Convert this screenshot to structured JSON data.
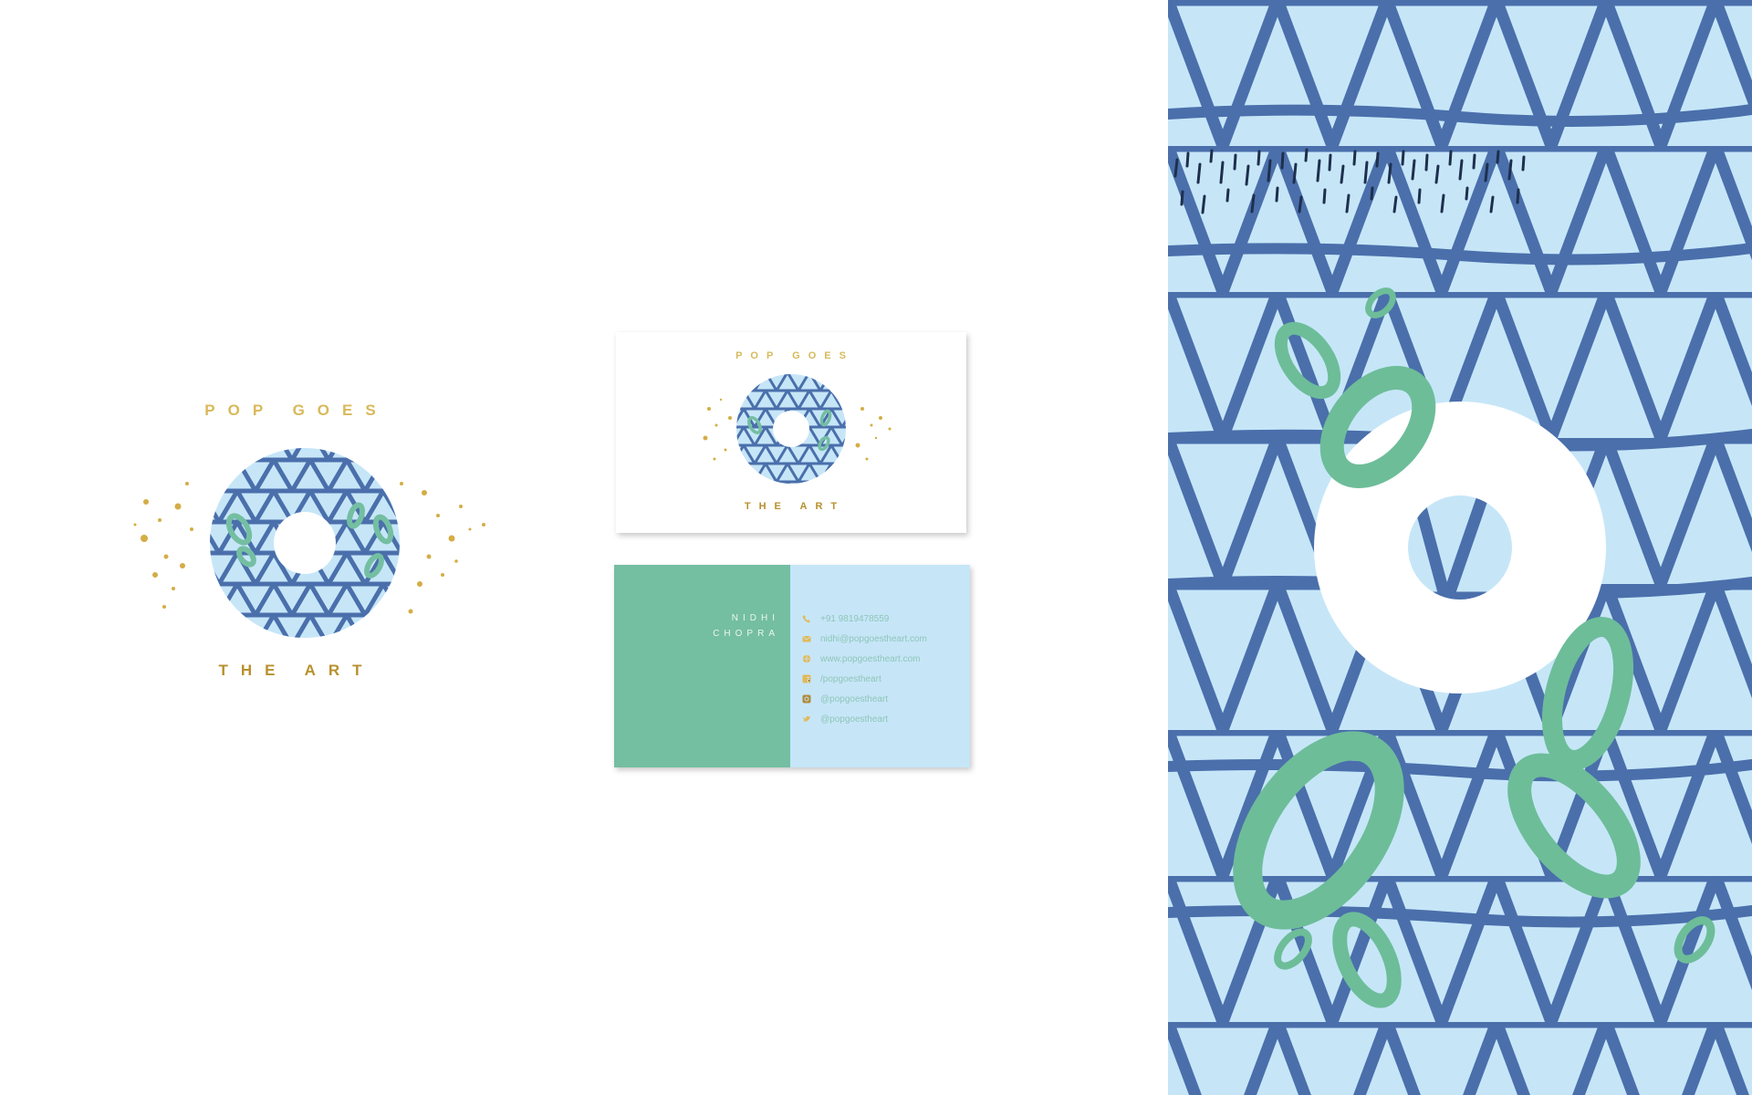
{
  "logo": {
    "top_text": "POP GOES",
    "bottom_text": "THE ART"
  },
  "card_front": {
    "top_text": "POP GOES",
    "bottom_text": "THE ART"
  },
  "card_back": {
    "name_first": "NIDHI",
    "name_last": "CHOPRA",
    "contacts": [
      {
        "icon": "phone-icon",
        "text": "+91 9819478559"
      },
      {
        "icon": "mail-icon",
        "text": "nidhi@popgoestheart.com"
      },
      {
        "icon": "globe-icon",
        "text": "www.popgoestheart.com"
      },
      {
        "icon": "facebook-icon",
        "text": "/popgoestheart"
      },
      {
        "icon": "instagram-icon",
        "text": "@popgoestheart"
      },
      {
        "icon": "twitter-icon",
        "text": "@popgoestheart"
      }
    ]
  },
  "colors": {
    "gold": "#c9a23a",
    "navy": "#4a6fab",
    "light_blue": "#c6e6f8",
    "green": "#74bea2",
    "white": "#ffffff"
  }
}
